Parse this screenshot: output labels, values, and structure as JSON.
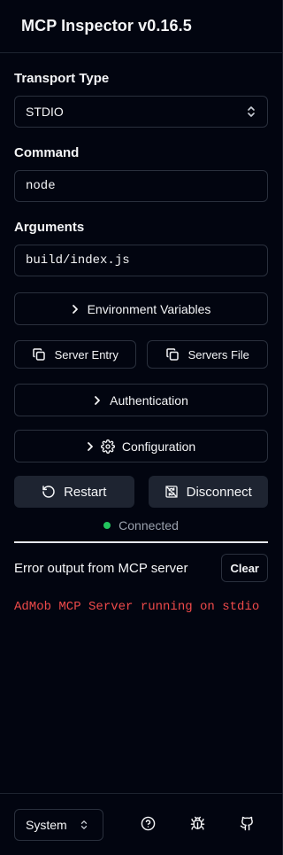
{
  "app": {
    "title": "MCP Inspector v0.16.5"
  },
  "transport": {
    "label": "Transport Type",
    "value": "STDIO"
  },
  "command": {
    "label": "Command",
    "value": "node"
  },
  "arguments": {
    "label": "Arguments",
    "value": "build/index.js"
  },
  "buttons": {
    "env_vars": "Environment Variables",
    "server_entry": "Server Entry",
    "servers_file": "Servers File",
    "authentication": "Authentication",
    "configuration": "Configuration",
    "restart": "Restart",
    "disconnect": "Disconnect"
  },
  "status": {
    "text": "Connected",
    "color": "#22c55e"
  },
  "error_output": {
    "title": "Error output from MCP server",
    "clear_label": "Clear",
    "lines": [
      "AdMob MCP Server running on stdio"
    ],
    "line_color": "#ef4a4a"
  },
  "footer": {
    "theme_value": "System",
    "icons": [
      "help-circle-icon",
      "bug-icon",
      "github-icon"
    ]
  }
}
